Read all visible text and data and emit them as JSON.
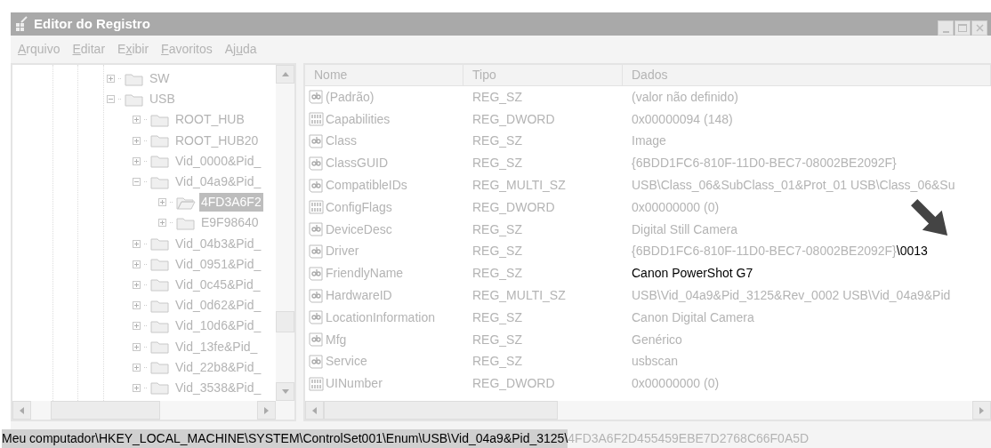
{
  "window": {
    "title": "Editor do Registro"
  },
  "menu": [
    {
      "key": "A",
      "post": "rquivo"
    },
    {
      "key": "E",
      "post": "ditar"
    },
    {
      "pre": "E",
      "key": "x",
      "post": "ibir"
    },
    {
      "key": "F",
      "post": "avoritos"
    },
    {
      "pre": "Aj",
      "key": "u",
      "post": "da"
    }
  ],
  "tree": [
    {
      "label": "SW",
      "expanded": false,
      "selected": false
    },
    {
      "label": "USB",
      "expanded": true,
      "selected": false,
      "children": [
        {
          "label": "ROOT_HUB",
          "expanded": false,
          "selected": false
        },
        {
          "label": "ROOT_HUB20",
          "expanded": false,
          "selected": false
        },
        {
          "label": "Vid_0000&Pid_",
          "expanded": false,
          "selected": false
        },
        {
          "label": "Vid_04a9&Pid_",
          "expanded": true,
          "selected": false,
          "children": [
            {
              "label": "4FD3A6F2",
              "expanded": false,
              "selected": true
            },
            {
              "label": "E9F98640",
              "expanded": false,
              "selected": false
            }
          ]
        },
        {
          "label": "Vid_04b3&Pid_",
          "expanded": false,
          "selected": false
        },
        {
          "label": "Vid_0951&Pid_",
          "expanded": false,
          "selected": false
        },
        {
          "label": "Vid_0c45&Pid_",
          "expanded": false,
          "selected": false
        },
        {
          "label": "Vid_0d62&Pid_",
          "expanded": false,
          "selected": false
        },
        {
          "label": "Vid_10d6&Pid_",
          "expanded": false,
          "selected": false
        },
        {
          "label": "Vid_13fe&Pid_",
          "expanded": false,
          "selected": false
        },
        {
          "label": "Vid_22b8&Pid_",
          "expanded": false,
          "selected": false
        },
        {
          "label": "Vid_3538&Pid_",
          "expanded": false,
          "selected": false
        }
      ]
    }
  ],
  "table": {
    "columns": [
      "Nome",
      "Tipo",
      "Dados"
    ],
    "rows": [
      {
        "kind": "string",
        "name": "(Padrão)",
        "type": "REG_SZ",
        "data": [
          {
            "text": "(valor não definido)",
            "emphasized": false
          }
        ]
      },
      {
        "kind": "binary",
        "name": "Capabilities",
        "type": "REG_DWORD",
        "data": [
          {
            "text": "0x00000094 (148)",
            "emphasized": false
          }
        ]
      },
      {
        "kind": "string",
        "name": "Class",
        "type": "REG_SZ",
        "data": [
          {
            "text": "Image",
            "emphasized": false
          }
        ]
      },
      {
        "kind": "string",
        "name": "ClassGUID",
        "type": "REG_SZ",
        "data": [
          {
            "text": "{6BDD1FC6-810F-11D0-BEC7-08002BE2092F}",
            "emphasized": false
          }
        ]
      },
      {
        "kind": "string",
        "name": "CompatibleIDs",
        "type": "REG_MULTI_SZ",
        "data": [
          {
            "text": "USB\\Class_06&SubClass_01&Prot_01 USB\\Class_06&Su",
            "emphasized": false
          }
        ]
      },
      {
        "kind": "binary",
        "name": "ConfigFlags",
        "type": "REG_DWORD",
        "data": [
          {
            "text": "0x00000000 (0)",
            "emphasized": false
          }
        ]
      },
      {
        "kind": "string",
        "name": "DeviceDesc",
        "type": "REG_SZ",
        "data": [
          {
            "text": "Digital Still Camera",
            "emphasized": false
          }
        ]
      },
      {
        "kind": "string",
        "name": "Driver",
        "type": "REG_SZ",
        "data": [
          {
            "text": "{6BDD1FC6-810F-11D0-BEC7-08002BE2092F}",
            "emphasized": false
          },
          {
            "text": "\\0013",
            "emphasized": true
          }
        ]
      },
      {
        "kind": "string",
        "name": "FriendlyName",
        "type": "REG_SZ",
        "data": [
          {
            "text": "Canon PowerShot G7",
            "emphasized": true
          }
        ]
      },
      {
        "kind": "string",
        "name": "HardwareID",
        "type": "REG_MULTI_SZ",
        "data": [
          {
            "text": "USB\\Vid_04a9&Pid_3125&Rev_0002 USB\\Vid_04a9&Pid",
            "emphasized": false
          }
        ]
      },
      {
        "kind": "string",
        "name": "LocationInformation",
        "type": "REG_SZ",
        "data": [
          {
            "text": "Canon Digital Camera",
            "emphasized": false
          }
        ]
      },
      {
        "kind": "string",
        "name": "Mfg",
        "type": "REG_SZ",
        "data": [
          {
            "text": "Genérico",
            "emphasized": false
          }
        ]
      },
      {
        "kind": "string",
        "name": "Service",
        "type": "REG_SZ",
        "data": [
          {
            "text": "usbscan",
            "emphasized": false
          }
        ]
      },
      {
        "kind": "binary",
        "name": "UINumber",
        "type": "REG_DWORD",
        "data": [
          {
            "text": "0x00000000 (0)",
            "emphasized": false
          }
        ]
      }
    ]
  },
  "status_bar": [
    {
      "text": "Meu computador\\HKEY_LOCAL_MACHINE\\SYSTEM\\ControlSet001\\Enum\\USB\\Vid_04a9&Pid_3125\\",
      "emphasized": true
    },
    {
      "text": "4FD3A6F2D455459EBE7D2768C66F0A5D",
      "emphasized": false
    }
  ]
}
